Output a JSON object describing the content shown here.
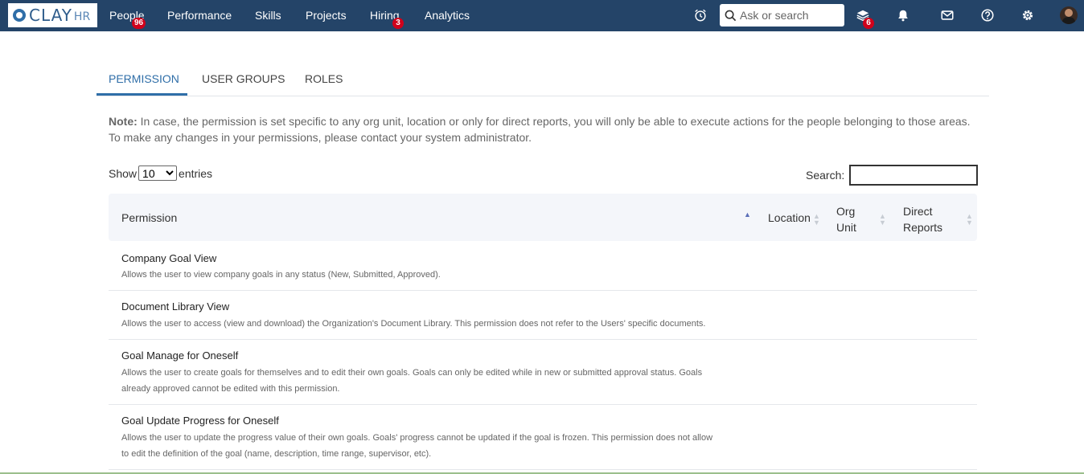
{
  "app": {
    "logo_text": "CLAY",
    "logo_sub": "HR"
  },
  "nav": {
    "items": [
      {
        "label": "People",
        "badge": "96"
      },
      {
        "label": "Performance"
      },
      {
        "label": "Skills"
      },
      {
        "label": "Projects"
      },
      {
        "label": "Hiring",
        "badge": "3"
      },
      {
        "label": "Analytics"
      }
    ],
    "search_placeholder": "Ask or search",
    "learning_badge": "6"
  },
  "tabs": [
    {
      "label": "PERMISSION",
      "active": true
    },
    {
      "label": "USER GROUPS",
      "active": false
    },
    {
      "label": "ROLES",
      "active": false
    }
  ],
  "note": {
    "bold": "Note:",
    "line1": " In case, the permission is set specific to any org unit, location or only for direct reports, you will only be able to execute actions for the people belonging to those areas.",
    "line2": "To make any changes in your permissions, please contact your system administrator."
  },
  "table_controls": {
    "show_label": "Show",
    "entries_value": "10",
    "entries_label": "entries",
    "search_label": "Search:"
  },
  "columns": {
    "permission": "Permission",
    "location": "Location",
    "org_unit_1": "Org",
    "org_unit_2": "Unit",
    "direct_1": "Direct",
    "direct_2": "Reports"
  },
  "rows": [
    {
      "title": "Company Goal View",
      "desc": [
        "Allows the user to view company goals in any status (New, Submitted, Approved)."
      ]
    },
    {
      "title": "Document Library View",
      "desc": [
        "Allows the user to access (view and download) the Organization's Document Library. This permission does not refer to the Users' specific documents."
      ]
    },
    {
      "title": "Goal Manage for Oneself",
      "desc": [
        "Allows the user to create goals for themselves and to edit their own goals. Goals can only be edited while in new or submitted approval status. Goals",
        "already approved cannot be edited with this permission."
      ]
    },
    {
      "title": "Goal Update Progress for Oneself",
      "desc": [
        "Allows the user to update the progress value of their own goals. Goals' progress cannot be updated if the goal is frozen. This permission does not allow",
        "to edit the definition of the goal (name, description, time range, supervisor, etc)."
      ]
    }
  ]
}
